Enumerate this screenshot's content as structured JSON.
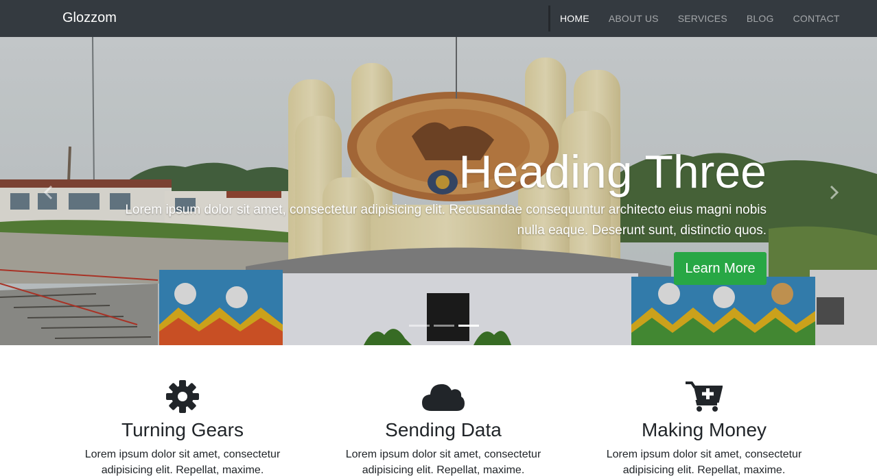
{
  "navbar": {
    "brand": "Glozzom",
    "links": [
      {
        "label": "HOME",
        "active": true
      },
      {
        "label": "ABOUT US",
        "active": false
      },
      {
        "label": "SERVICES",
        "active": false
      },
      {
        "label": "BLOG",
        "active": false
      },
      {
        "label": "CONTACT",
        "active": false
      }
    ]
  },
  "hero": {
    "heading": "Heading Three",
    "text": "Lorem ipsum dolor sit amet, consectetur adipisicing elit. Recusandae consequuntur architecto eius magni nobis nulla eaque. Deserunt sunt, distinctio quos.",
    "button_label": "Learn More",
    "prev_icon": "chevron-left-icon",
    "next_icon": "chevron-right-icon",
    "active_slide": 3,
    "slide_count": 3
  },
  "features": [
    {
      "icon": "gear-icon",
      "title": "Turning Gears",
      "text": "Lorem ipsum dolor sit amet, consectetur adipisicing elit. Repellat, maxime."
    },
    {
      "icon": "cloud-icon",
      "title": "Sending Data",
      "text": "Lorem ipsum dolor sit amet, consectetur adipisicing elit. Repellat, maxime."
    },
    {
      "icon": "cart-plus-icon",
      "title": "Making Money",
      "text": "Lorem ipsum dolor sit amet, consectetur adipisicing elit. Repellat, maxime."
    }
  ],
  "colors": {
    "navbar_bg": "#343a40",
    "button_success": "#28a745",
    "text_dark": "#212529"
  }
}
